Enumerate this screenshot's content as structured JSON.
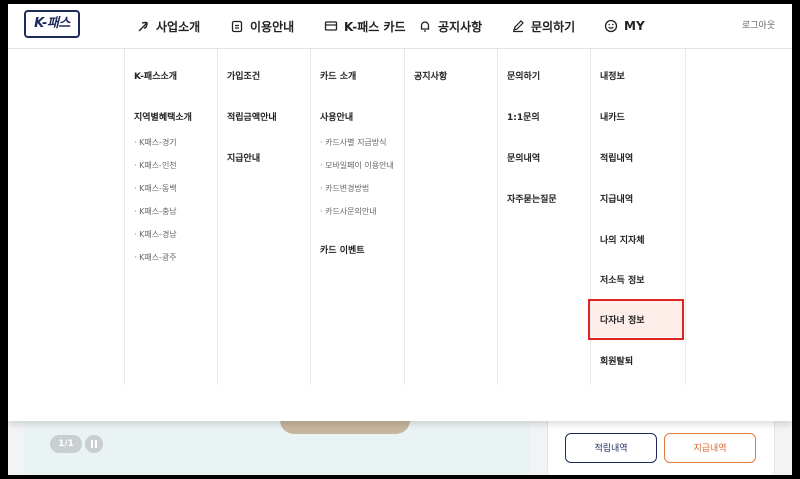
{
  "header": {
    "logo": "K-패스",
    "nav": [
      {
        "label": "사업소개",
        "icon": "plant-icon"
      },
      {
        "label": "이용안내",
        "icon": "clipboard-icon"
      },
      {
        "label": "K-패스 카드",
        "icon": "card-icon"
      },
      {
        "label": "공지사항",
        "icon": "bell-icon"
      },
      {
        "label": "문의하기",
        "icon": "pencil-icon"
      },
      {
        "label": "MY",
        "icon": "smile-icon"
      }
    ],
    "logout": "로그아웃"
  },
  "menu": {
    "col1": {
      "item1": "K-패스소개",
      "item2": "지역별혜택소개",
      "subs": [
        "· K패스-경기",
        "· K패스-인천",
        "· K패스-동백",
        "· K패스-충남",
        "· K패스-경남",
        "· K패스-광주"
      ]
    },
    "col2": {
      "items": [
        "가입조건",
        "적립금액안내",
        "지급안내"
      ]
    },
    "col3": {
      "item1": "카드 소개",
      "item2": "사용안내",
      "subs": [
        "· 카드사별 지급방식",
        "· 모바일페이 이용안내",
        "· 카드변경방법",
        "· 카드사문의안내"
      ],
      "item3": "카드 이벤트"
    },
    "col4": {
      "items": [
        "공지사항"
      ]
    },
    "col5": {
      "items": [
        "문의하기",
        "1:1문의",
        "문의내역",
        "자주묻는질문"
      ]
    },
    "col6": {
      "items": [
        "내정보",
        "내카드",
        "적립내역",
        "지급내역",
        "나의 지자체",
        "저소득 정보",
        "다자녀 정보",
        "회원탈퇴"
      ]
    }
  },
  "banner": {
    "pager": "1/1"
  },
  "card": {
    "btn_accrual": "적립내역",
    "btn_payment": "지급내역"
  },
  "colors": {
    "brand": "#1f2a5c",
    "highlight_bg": "#fdeeea",
    "annotation": "#e02424",
    "accent": "#e0662a"
  }
}
